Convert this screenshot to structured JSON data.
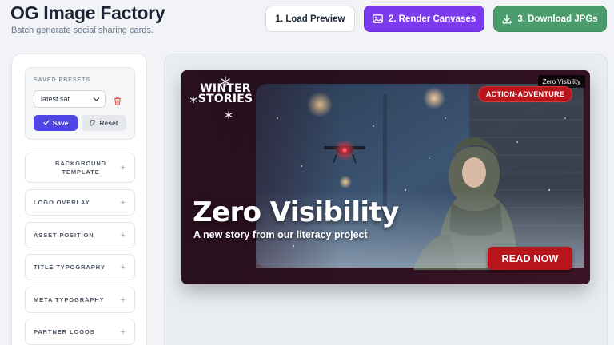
{
  "header": {
    "title": "OG Image Factory",
    "subtitle": "Batch generate social sharing cards."
  },
  "toolbar": {
    "load_label": "1. Load Preview",
    "render_label": "2. Render Canvases",
    "download_label": "3. Download JPGs"
  },
  "sidebar": {
    "presets": {
      "heading": "SAVED PRESETS",
      "selected": "latest sat",
      "save_label": "Save",
      "reset_label": "Reset"
    },
    "sections": [
      "BACKGROUND TEMPLATE",
      "LOGO OVERLAY",
      "ASSET POSITION",
      "TITLE TYPOGRAPHY",
      "META TYPOGRAPHY",
      "PARTNER LOGOS"
    ]
  },
  "preview": {
    "corner_tag": "Zero Visibility",
    "brand": "WINTER STORIES",
    "genre": "ACTION-ADVENTURE",
    "title": "Zero Visibility",
    "subtitle": "A new story from our literacy project",
    "cta": "READ NOW"
  },
  "colors": {
    "render_button": "#7c3aed",
    "download_button": "#4a9c6c",
    "save_button": "#4f46e5",
    "accent_red": "#b8141c"
  },
  "icons": {
    "render": "image-icon",
    "download": "download-icon",
    "delete": "trash-icon",
    "save": "check-icon",
    "reset": "reset-icon",
    "expand": "plus-icon",
    "select": "chevron-down-icon",
    "brand": "snowflake-icon"
  }
}
